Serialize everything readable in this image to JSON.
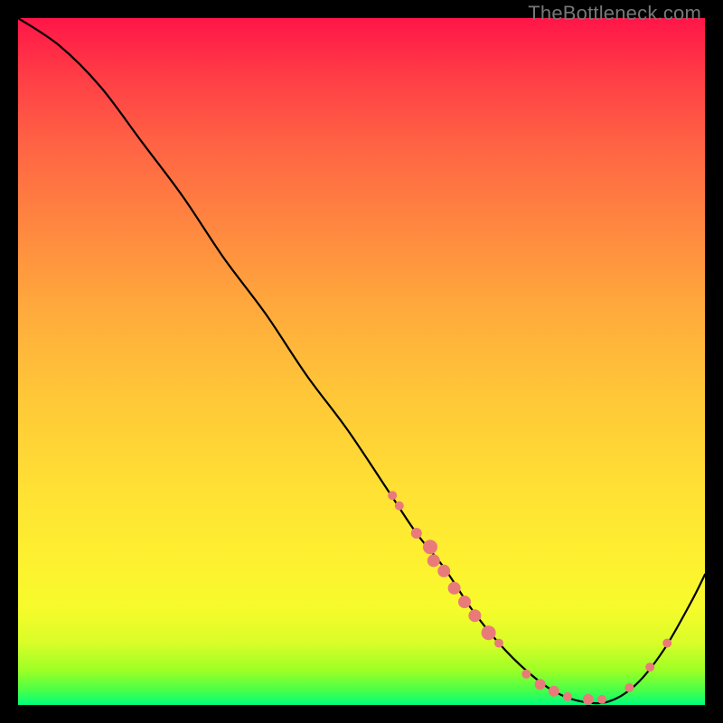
{
  "watermark": "TheBottleneck.com",
  "chart_data": {
    "type": "line",
    "title": "",
    "xlabel": "",
    "ylabel": "",
    "xlim": [
      0,
      100
    ],
    "ylim": [
      0,
      100
    ],
    "series": [
      {
        "name": "curve",
        "x": [
          0,
          6,
          12,
          18,
          24,
          30,
          36,
          42,
          48,
          54,
          58,
          62,
          66,
          70,
          74,
          78,
          82,
          86,
          90,
          94,
          98,
          100
        ],
        "y": [
          100,
          96,
          90,
          82,
          74,
          65,
          57,
          48,
          40,
          31,
          25,
          20,
          14,
          9,
          5,
          2,
          0.5,
          0.5,
          3,
          8,
          15,
          19
        ]
      }
    ],
    "markers": [
      {
        "x": 54.5,
        "y": 30.5,
        "r": 5
      },
      {
        "x": 55.5,
        "y": 29.0,
        "r": 5
      },
      {
        "x": 58.0,
        "y": 25.0,
        "r": 6
      },
      {
        "x": 60.0,
        "y": 23.0,
        "r": 8
      },
      {
        "x": 60.5,
        "y": 21.0,
        "r": 7
      },
      {
        "x": 62.0,
        "y": 19.5,
        "r": 7
      },
      {
        "x": 63.5,
        "y": 17.0,
        "r": 7
      },
      {
        "x": 65.0,
        "y": 15.0,
        "r": 7
      },
      {
        "x": 66.5,
        "y": 13.0,
        "r": 7
      },
      {
        "x": 68.5,
        "y": 10.5,
        "r": 8
      },
      {
        "x": 70.0,
        "y": 9.0,
        "r": 5
      },
      {
        "x": 74.0,
        "y": 4.5,
        "r": 5
      },
      {
        "x": 76.0,
        "y": 3.0,
        "r": 6
      },
      {
        "x": 78.0,
        "y": 2.0,
        "r": 6
      },
      {
        "x": 80.0,
        "y": 1.2,
        "r": 5
      },
      {
        "x": 83.0,
        "y": 0.8,
        "r": 6
      },
      {
        "x": 85.0,
        "y": 0.8,
        "r": 5
      },
      {
        "x": 89.0,
        "y": 2.5,
        "r": 5
      },
      {
        "x": 92.0,
        "y": 5.5,
        "r": 5
      },
      {
        "x": 94.5,
        "y": 9.0,
        "r": 5
      }
    ],
    "marker_color": "#e97a7a",
    "background_gradient": [
      "#ff1548",
      "#ffe333",
      "#00ff7f"
    ]
  }
}
